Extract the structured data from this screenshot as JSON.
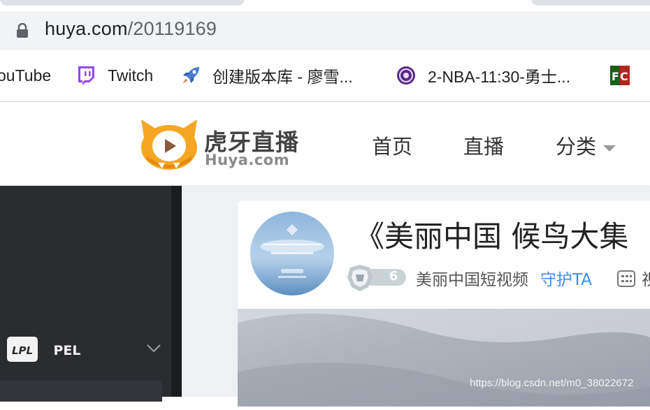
{
  "browser": {
    "url_host": "huya.com",
    "url_path": "/20119169",
    "bookmarks": [
      {
        "label": "ouTube",
        "icon": "youtube-icon"
      },
      {
        "label": "Twitch",
        "icon": "twitch-icon"
      },
      {
        "label": "创建版本库 - 廖雪...",
        "icon": "rocket-icon"
      },
      {
        "label": "2-NBA-11:30-勇士...",
        "icon": "nba-site-icon"
      },
      {
        "label": "",
        "icon": "fc-icon"
      }
    ]
  },
  "header": {
    "logo_cn": "虎牙直播",
    "logo_en": "Huya.com",
    "nav": [
      "首页",
      "直播",
      "分类"
    ]
  },
  "sidebar": {
    "games": [
      "LPL",
      "PEL"
    ]
  },
  "room": {
    "title": "《美丽中国 候鸟大集",
    "level": "6",
    "anchor_name": "美丽中国短视频",
    "guard_label": "守护TA",
    "category": "视"
  },
  "watermark": "https://blog.csdn.net/m0_38022672",
  "colors": {
    "brand_orange": "#f5a623",
    "link_blue": "#3a8ef6",
    "sidebar_bg": "#2b2c30"
  }
}
